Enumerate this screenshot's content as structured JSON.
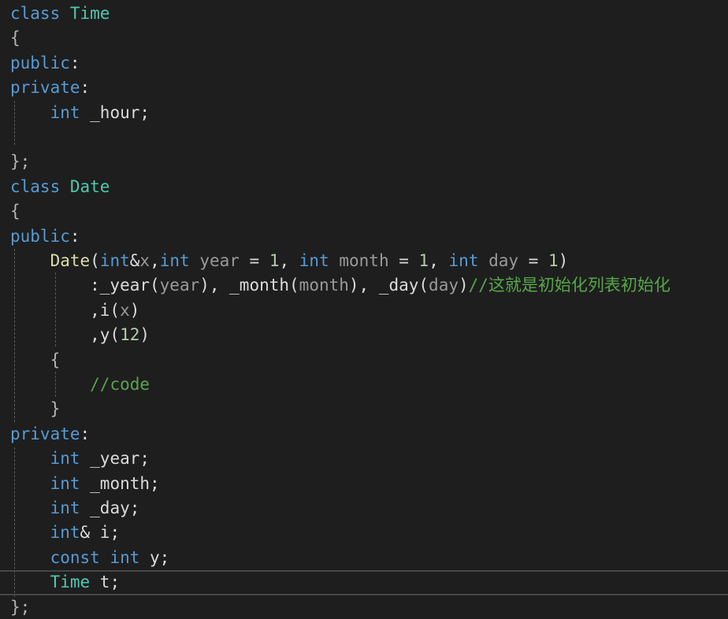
{
  "editor": {
    "language": "cpp",
    "colors": {
      "background": "#1e1e1e",
      "keyword": "#569cd6",
      "type": "#4ec9b0",
      "function": "#dcdcaa",
      "parameter": "#9a9a9a",
      "number": "#b5cea8",
      "comment": "#57a64a",
      "text": "#dcdcdc"
    },
    "lines": [
      [
        {
          "t": "class",
          "c": "kw"
        },
        {
          "t": " ",
          "c": "pl"
        },
        {
          "t": "Time",
          "c": "type"
        }
      ],
      [
        {
          "t": "{",
          "c": "pn"
        }
      ],
      [
        {
          "t": "public",
          "c": "kw"
        },
        {
          "t": ":",
          "c": "pl"
        }
      ],
      [
        {
          "t": "private",
          "c": "kw"
        },
        {
          "t": ":",
          "c": "pl"
        }
      ],
      [
        {
          "t": "    ",
          "c": "pl"
        },
        {
          "t": "int",
          "c": "kw"
        },
        {
          "t": " _hour;",
          "c": "pl"
        }
      ],
      [
        {
          "t": "",
          "c": "pl"
        }
      ],
      [
        {
          "t": "};",
          "c": "pn"
        }
      ],
      [
        {
          "t": "class",
          "c": "kw"
        },
        {
          "t": " ",
          "c": "pl"
        },
        {
          "t": "Date",
          "c": "type"
        }
      ],
      [
        {
          "t": "{",
          "c": "pn"
        }
      ],
      [
        {
          "t": "public",
          "c": "kw"
        },
        {
          "t": ":",
          "c": "pl"
        }
      ],
      [
        {
          "t": "    ",
          "c": "pl"
        },
        {
          "t": "Date",
          "c": "fn"
        },
        {
          "t": "(",
          "c": "pl"
        },
        {
          "t": "int",
          "c": "kw"
        },
        {
          "t": "&",
          "c": "pl"
        },
        {
          "t": "x",
          "c": "param"
        },
        {
          "t": ",",
          "c": "pl"
        },
        {
          "t": "int",
          "c": "kw"
        },
        {
          "t": " ",
          "c": "pl"
        },
        {
          "t": "year",
          "c": "param"
        },
        {
          "t": " = ",
          "c": "pl"
        },
        {
          "t": "1",
          "c": "num"
        },
        {
          "t": ", ",
          "c": "pl"
        },
        {
          "t": "int",
          "c": "kw"
        },
        {
          "t": " ",
          "c": "pl"
        },
        {
          "t": "month",
          "c": "param"
        },
        {
          "t": " = ",
          "c": "pl"
        },
        {
          "t": "1",
          "c": "num"
        },
        {
          "t": ", ",
          "c": "pl"
        },
        {
          "t": "int",
          "c": "kw"
        },
        {
          "t": " ",
          "c": "pl"
        },
        {
          "t": "day",
          "c": "param"
        },
        {
          "t": " = ",
          "c": "pl"
        },
        {
          "t": "1",
          "c": "num"
        },
        {
          "t": ")",
          "c": "pl"
        }
      ],
      [
        {
          "t": "        :_year(",
          "c": "pl"
        },
        {
          "t": "year",
          "c": "param"
        },
        {
          "t": "), _month(",
          "c": "pl"
        },
        {
          "t": "month",
          "c": "param"
        },
        {
          "t": "), _day(",
          "c": "pl"
        },
        {
          "t": "day",
          "c": "param"
        },
        {
          "t": ")",
          "c": "pl"
        },
        {
          "t": "//这就是初始化列表初始化",
          "c": "cm"
        }
      ],
      [
        {
          "t": "        ,i(",
          "c": "pl"
        },
        {
          "t": "x",
          "c": "param"
        },
        {
          "t": ")",
          "c": "pl"
        }
      ],
      [
        {
          "t": "        ,y(",
          "c": "pl"
        },
        {
          "t": "12",
          "c": "num"
        },
        {
          "t": ")",
          "c": "pl"
        }
      ],
      [
        {
          "t": "    {",
          "c": "pn"
        }
      ],
      [
        {
          "t": "        ",
          "c": "pl"
        },
        {
          "t": "//code",
          "c": "cm"
        }
      ],
      [
        {
          "t": "    }",
          "c": "pn"
        }
      ],
      [
        {
          "t": "private",
          "c": "kw"
        },
        {
          "t": ":",
          "c": "pl"
        }
      ],
      [
        {
          "t": "    ",
          "c": "pl"
        },
        {
          "t": "int",
          "c": "kw"
        },
        {
          "t": " _year;",
          "c": "pl"
        }
      ],
      [
        {
          "t": "    ",
          "c": "pl"
        },
        {
          "t": "int",
          "c": "kw"
        },
        {
          "t": " _month;",
          "c": "pl"
        }
      ],
      [
        {
          "t": "    ",
          "c": "pl"
        },
        {
          "t": "int",
          "c": "kw"
        },
        {
          "t": " _day;",
          "c": "pl"
        }
      ],
      [
        {
          "t": "    ",
          "c": "pl"
        },
        {
          "t": "int",
          "c": "kw"
        },
        {
          "t": "& i;",
          "c": "pl"
        }
      ],
      [
        {
          "t": "    ",
          "c": "pl"
        },
        {
          "t": "const",
          "c": "kw"
        },
        {
          "t": " ",
          "c": "pl"
        },
        {
          "t": "int",
          "c": "kw"
        },
        {
          "t": " y;",
          "c": "pl"
        }
      ],
      [
        {
          "t": "    ",
          "c": "pl"
        },
        {
          "t": "Time",
          "c": "type"
        },
        {
          "t": " t;",
          "c": "pl"
        }
      ],
      [
        {
          "t": "};",
          "c": "pn"
        }
      ]
    ],
    "current_line": 23
  }
}
